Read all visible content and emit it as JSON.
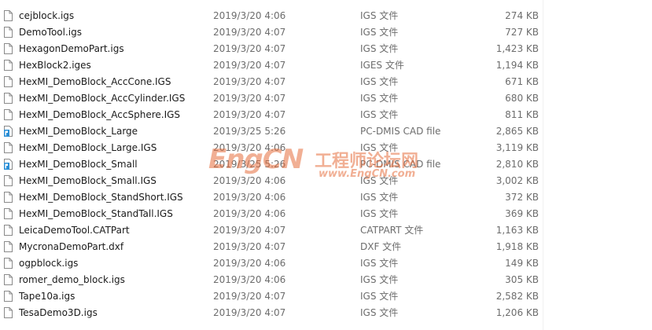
{
  "colors": {
    "accent": "#e66e3c",
    "meta_text": "#6d6d6d"
  },
  "files": [
    {
      "name": "cejblock.igs",
      "date": "2019/3/20 4:06",
      "type": "IGS 文件",
      "size": "274 KB",
      "icon": "document-icon"
    },
    {
      "name": "DemoTool.igs",
      "date": "2019/3/20 4:07",
      "type": "IGS 文件",
      "size": "727 KB",
      "icon": "document-icon"
    },
    {
      "name": "HexagonDemoPart.igs",
      "date": "2019/3/20 4:07",
      "type": "IGS 文件",
      "size": "1,423 KB",
      "icon": "document-icon"
    },
    {
      "name": "HexBlock2.iges",
      "date": "2019/3/20 4:07",
      "type": "IGES 文件",
      "size": "1,194 KB",
      "icon": "document-icon"
    },
    {
      "name": "HexMI_DemoBlock_AccCone.IGS",
      "date": "2019/3/20 4:07",
      "type": "IGS 文件",
      "size": "671 KB",
      "icon": "document-icon"
    },
    {
      "name": "HexMI_DemoBlock_AccCylinder.IGS",
      "date": "2019/3/20 4:07",
      "type": "IGS 文件",
      "size": "680 KB",
      "icon": "document-icon"
    },
    {
      "name": "HexMI_DemoBlock_AccSphere.IGS",
      "date": "2019/3/20 4:07",
      "type": "IGS 文件",
      "size": "811 KB",
      "icon": "document-icon"
    },
    {
      "name": "HexMI_DemoBlock_Large",
      "date": "2019/3/25 5:26",
      "type": "PC-DMIS CAD file",
      "size": "2,865 KB",
      "icon": "pcdmis-file-icon"
    },
    {
      "name": "HexMI_DemoBlock_Large.IGS",
      "date": "2019/3/20 4:06",
      "type": "IGS 文件",
      "size": "3,119 KB",
      "icon": "document-icon"
    },
    {
      "name": "HexMI_DemoBlock_Small",
      "date": "2019/3/25 5:26",
      "type": "PC-DMIS CAD file",
      "size": "2,810 KB",
      "icon": "pcdmis-file-icon"
    },
    {
      "name": "HexMI_DemoBlock_Small.IGS",
      "date": "2019/3/20 4:06",
      "type": "IGS 文件",
      "size": "3,002 KB",
      "icon": "document-icon"
    },
    {
      "name": "HexMI_DemoBlock_StandShort.IGS",
      "date": "2019/3/20 4:06",
      "type": "IGS 文件",
      "size": "372 KB",
      "icon": "document-icon"
    },
    {
      "name": "HexMI_DemoBlock_StandTall.IGS",
      "date": "2019/3/20 4:06",
      "type": "IGS 文件",
      "size": "369 KB",
      "icon": "document-icon"
    },
    {
      "name": "LeicaDemoTool.CATPart",
      "date": "2019/3/20 4:07",
      "type": "CATPART 文件",
      "size": "1,163 KB",
      "icon": "document-icon"
    },
    {
      "name": "MycronaDemoPart.dxf",
      "date": "2019/3/20 4:07",
      "type": "DXF 文件",
      "size": "1,918 KB",
      "icon": "document-icon"
    },
    {
      "name": "ogpblock.igs",
      "date": "2019/3/20 4:06",
      "type": "IGS 文件",
      "size": "149 KB",
      "icon": "document-icon"
    },
    {
      "name": "romer_demo_block.igs",
      "date": "2019/3/20 4:06",
      "type": "IGS 文件",
      "size": "305 KB",
      "icon": "document-icon"
    },
    {
      "name": "Tape10a.igs",
      "date": "2019/3/20 4:07",
      "type": "IGS 文件",
      "size": "2,582 KB",
      "icon": "document-icon"
    },
    {
      "name": "TesaDemo3D.igs",
      "date": "2019/3/20 4:07",
      "type": "IGS 文件",
      "size": "1,206 KB",
      "icon": "document-icon"
    }
  ],
  "watermark": {
    "logo": "EngCN",
    "chinese": "工程师论坛网",
    "url": "www.EngCN.com"
  }
}
